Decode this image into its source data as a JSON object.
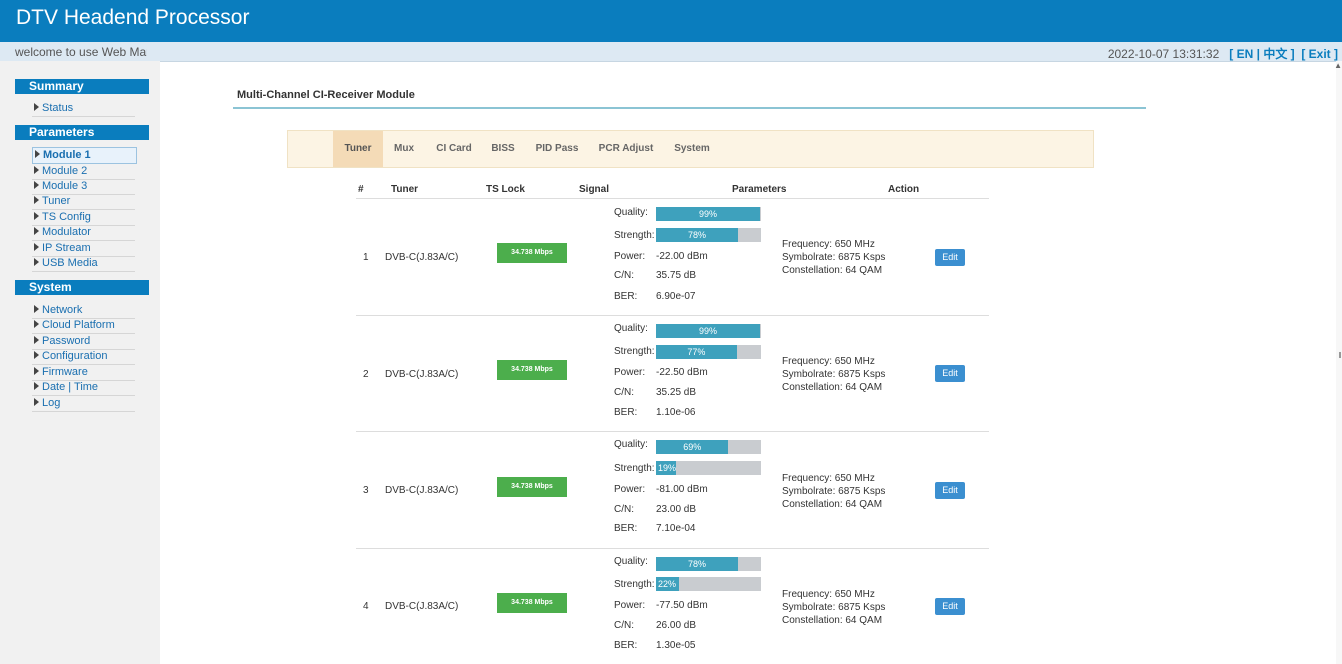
{
  "app_title": "DTV Headend Processor",
  "welcome": "welcome to use Web Management",
  "datetime": "2022-10-07 13:31:32",
  "lang_en": "[ EN |",
  "lang_zh": "中文 ]",
  "exit": "[ Exit ]",
  "sidebar": {
    "summary": {
      "title": "Summary",
      "items": [
        "Status"
      ]
    },
    "parameters": {
      "title": "Parameters",
      "items": [
        "Module 1",
        "Module 2",
        "Module 3",
        "Tuner",
        "TS Config",
        "Modulator",
        "IP Stream",
        "USB Media"
      ]
    },
    "system": {
      "title": "System",
      "items": [
        "Network",
        "Cloud Platform",
        "Password",
        "Configuration",
        "Firmware",
        "Date | Time",
        "Log"
      ]
    }
  },
  "module_title": "Multi-Channel CI-Receiver Module",
  "tabs": [
    "Tuner",
    "Mux",
    "CI Card",
    "BISS",
    "PID Pass",
    "PCR Adjust",
    "System"
  ],
  "table_headers": [
    "#",
    "Tuner",
    "TS Lock",
    "Signal",
    "Parameters",
    "Action"
  ],
  "labels": {
    "quality": "Quality:",
    "strength": "Strength:",
    "power": "Power:",
    "cn": "C/N:",
    "ber": "BER:",
    "edit": "Edit"
  },
  "rows": [
    {
      "num": "1",
      "tuner": "DVB-C(J.83A/C)",
      "lock": "34.738 Mbps",
      "quality": 99,
      "strength": 78,
      "quality_text": "99%",
      "strength_text": "78%",
      "power": "-22.00 dBm",
      "cn": "35.75 dB",
      "ber": "6.90e-07",
      "frequency": "Frequency: 650 MHz",
      "symbolrate": "Symbolrate: 6875 Ksps",
      "constellation": "Constellation: 64 QAM"
    },
    {
      "num": "2",
      "tuner": "DVB-C(J.83A/C)",
      "lock": "34.738 Mbps",
      "quality": 99,
      "strength": 77,
      "quality_text": "99%",
      "strength_text": "77%",
      "power": "-22.50 dBm",
      "cn": "35.25 dB",
      "ber": "1.10e-06",
      "frequency": "Frequency: 650 MHz",
      "symbolrate": "Symbolrate: 6875 Ksps",
      "constellation": "Constellation: 64 QAM"
    },
    {
      "num": "3",
      "tuner": "DVB-C(J.83A/C)",
      "lock": "34.738 Mbps",
      "quality": 69,
      "strength": 19,
      "quality_text": "69%",
      "strength_text": "19%",
      "power": "-81.00 dBm",
      "cn": "23.00 dB",
      "ber": "7.10e-04",
      "frequency": "Frequency: 650 MHz",
      "symbolrate": "Symbolrate: 6875 Ksps",
      "constellation": "Constellation: 64 QAM"
    },
    {
      "num": "4",
      "tuner": "DVB-C(J.83A/C)",
      "lock": "34.738 Mbps",
      "quality": 78,
      "strength": 22,
      "quality_text": "78%",
      "strength_text": "22%",
      "power": "-77.50 dBm",
      "cn": "26.00 dB",
      "ber": "1.30e-05",
      "frequency": "Frequency: 650 MHz",
      "symbolrate": "Symbolrate: 6875 Ksps",
      "constellation": "Constellation: 64 QAM"
    }
  ],
  "colors": {
    "brand": "#0a7dbe",
    "lock_green": "#4cae4c",
    "bar_fill": "#3ea1bd",
    "edit_blue": "#3b8fd0"
  }
}
